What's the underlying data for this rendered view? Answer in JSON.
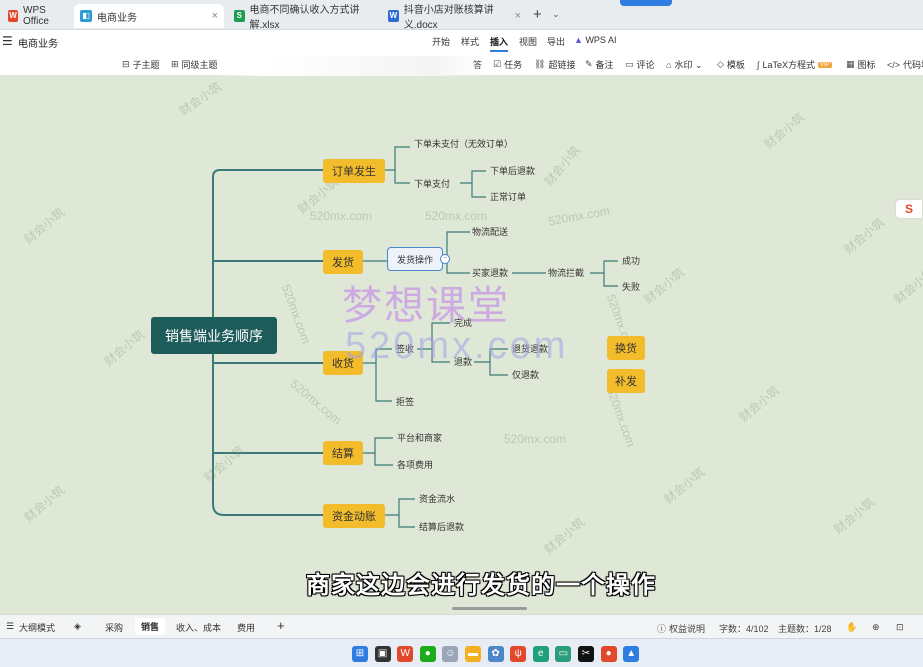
{
  "tabs": [
    {
      "label": "WPS Office",
      "icon": "wps-logo-icon",
      "color": "#e2482c"
    },
    {
      "label": "电商业务",
      "icon": "mindmap-icon",
      "color": "#2f9bd6",
      "active": true,
      "close": "×"
    },
    {
      "label": "电商不同确认收入方式讲解.xlsx",
      "icon": "spreadsheet-icon",
      "color": "#1f9d55",
      "icon_text": "S"
    },
    {
      "label": "抖音小店对账核算讲义.docx",
      "icon": "document-icon",
      "color": "#2f6ad6",
      "icon_text": "W",
      "close": "×"
    }
  ],
  "tab_add": "+",
  "tab_more": "⌄",
  "menubar": {
    "hamburger": "☰",
    "doc_title": "电商业务",
    "items": [
      "开始",
      "样式",
      "插入",
      "视图",
      "导出",
      "WPS AI"
    ],
    "active": "插入"
  },
  "toolbar": {
    "left": [
      {
        "icon": "subtopic-icon",
        "glyph": "⊟",
        "label": "子主题"
      },
      {
        "icon": "sibling-topic-icon",
        "glyph": "⊞",
        "label": "同级主题"
      }
    ],
    "right": [
      {
        "icon": "answer-icon",
        "glyph": "",
        "label": "答"
      },
      {
        "icon": "task-icon",
        "glyph": "☑",
        "label": "任务"
      },
      {
        "icon": "link-icon",
        "glyph": "⛓",
        "label": "超链接"
      },
      {
        "icon": "note-icon",
        "glyph": "✎",
        "label": "备注"
      },
      {
        "icon": "comment-icon",
        "glyph": "▭",
        "label": "评论"
      },
      {
        "icon": "watermark-icon",
        "glyph": "⌂",
        "label": "水印 ⌄"
      },
      {
        "icon": "template-icon",
        "glyph": "◇",
        "label": "模板"
      },
      {
        "icon": "latex-icon",
        "glyph": "∫",
        "label": "LaTeX方程式",
        "badge": "VIP"
      },
      {
        "icon": "chart-icon",
        "glyph": "▦",
        "label": "图标"
      },
      {
        "icon": "code-icon",
        "glyph": "</>",
        "label": "代码块"
      }
    ]
  },
  "mindmap": {
    "root": "销售端业务顺序",
    "order": {
      "label": "订单发生",
      "unpaid": "下单未支付（无效订单）",
      "paid": "下单支付",
      "refund_after": "下单后退款",
      "normal": "正常订单"
    },
    "ship": {
      "label": "发货",
      "op": "发货操作",
      "logistics": "物流配送",
      "buyer_refund": "买家退款",
      "intercept": "物流拦截",
      "success": "成功",
      "fail": "失败"
    },
    "receive": {
      "label": "收货",
      "sign": "签收",
      "complete": "完成",
      "refund": "退款",
      "return_refund": "退货退款",
      "refund_only": "仅退款",
      "reject": "拒签"
    },
    "settle": {
      "label": "结算",
      "platform": "平台和商家",
      "fees": "各项费用"
    },
    "capital": {
      "label": "资金动账",
      "flow": "资金流水",
      "settle_refund": "结算后退款"
    },
    "floating": {
      "exchange": "换货",
      "restock": "补发"
    }
  },
  "watermarks": {
    "site": "520mx.com",
    "brand": "财会小筑",
    "big1": "梦想课堂",
    "big2": "520mx.com"
  },
  "subtitle": "商家这边会进行发货的一个操作",
  "s_logo": "S",
  "sheetbar": {
    "outline_icon": "☰",
    "outline_mode": "大纲模式",
    "layers_icon": "◈",
    "tabs": [
      "采购",
      "销售",
      "收入、成本",
      "费用"
    ],
    "active_tab": "销售",
    "add": "+",
    "rights": "权益说明",
    "rights_icon": "ⓘ",
    "word_count": "字数：4/102",
    "topic_count": "主题数：1/28"
  },
  "taskbar": [
    {
      "icon": "windows-start-icon",
      "color": "#2f7de1",
      "glyph": "⊞"
    },
    {
      "icon": "task-view-icon",
      "color": "#333333",
      "glyph": "▣"
    },
    {
      "icon": "wps-taskbar-icon",
      "color": "#e2482c",
      "glyph": "W"
    },
    {
      "icon": "wechat-icon",
      "color": "#1aad19",
      "glyph": "●"
    },
    {
      "icon": "assistant-icon",
      "color": "#9aa6b8",
      "glyph": "☺"
    },
    {
      "icon": "folder-icon",
      "color": "#f2b01e",
      "glyph": "▬"
    },
    {
      "icon": "network-icon",
      "color": "#4a86c8",
      "glyph": "✿"
    },
    {
      "icon": "wifi-tool-icon",
      "color": "#e2482c",
      "glyph": "ψ"
    },
    {
      "icon": "edge-icon",
      "color": "#20a07a",
      "glyph": "e"
    },
    {
      "icon": "screen-icon",
      "color": "#2a9d7b",
      "glyph": "▭"
    },
    {
      "icon": "capcut-icon",
      "color": "#111111",
      "glyph": "✂"
    },
    {
      "icon": "record-icon",
      "color": "#e2482c",
      "glyph": "●"
    },
    {
      "icon": "video-icon",
      "color": "#2f7de1",
      "glyph": "▲"
    }
  ]
}
